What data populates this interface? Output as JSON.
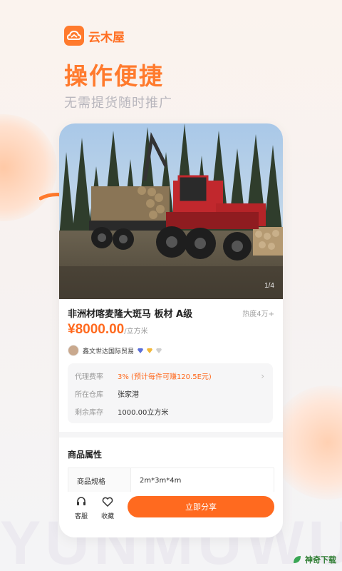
{
  "brand": {
    "name": "云木屋",
    "color": "#ff6f22"
  },
  "headline": "操作便捷",
  "subline": "无需提货随时推广",
  "watermark": "YUNMUWU",
  "photo": {
    "counter": "1/4"
  },
  "product": {
    "title": "非洲材喀麦隆大斑马 板材 A级",
    "heat": "热度4万+",
    "price": "¥8000.00",
    "price_unit": "/立方米",
    "seller": "鑫文世达国际贸易"
  },
  "info": [
    {
      "label": "代理费率",
      "value": "3% (预计每件可赚120.5E元)",
      "accent": true
    },
    {
      "label": "所在仓库",
      "value": "张家港",
      "accent": false
    },
    {
      "label": "剩余库存",
      "value": "1000.00立方米",
      "accent": false
    }
  ],
  "attributes": {
    "section_title": "商品属性",
    "rows": [
      {
        "key": "商品规格",
        "value": "2m*3m*4m"
      }
    ]
  },
  "bottom_bar": {
    "service": "客服",
    "favorite": "收藏",
    "share": "立即分享"
  },
  "corner_logo": "神奇下载",
  "colors": {
    "accent": "#ff6a1f",
    "text": "#222222",
    "muted": "#9a9a9a"
  }
}
